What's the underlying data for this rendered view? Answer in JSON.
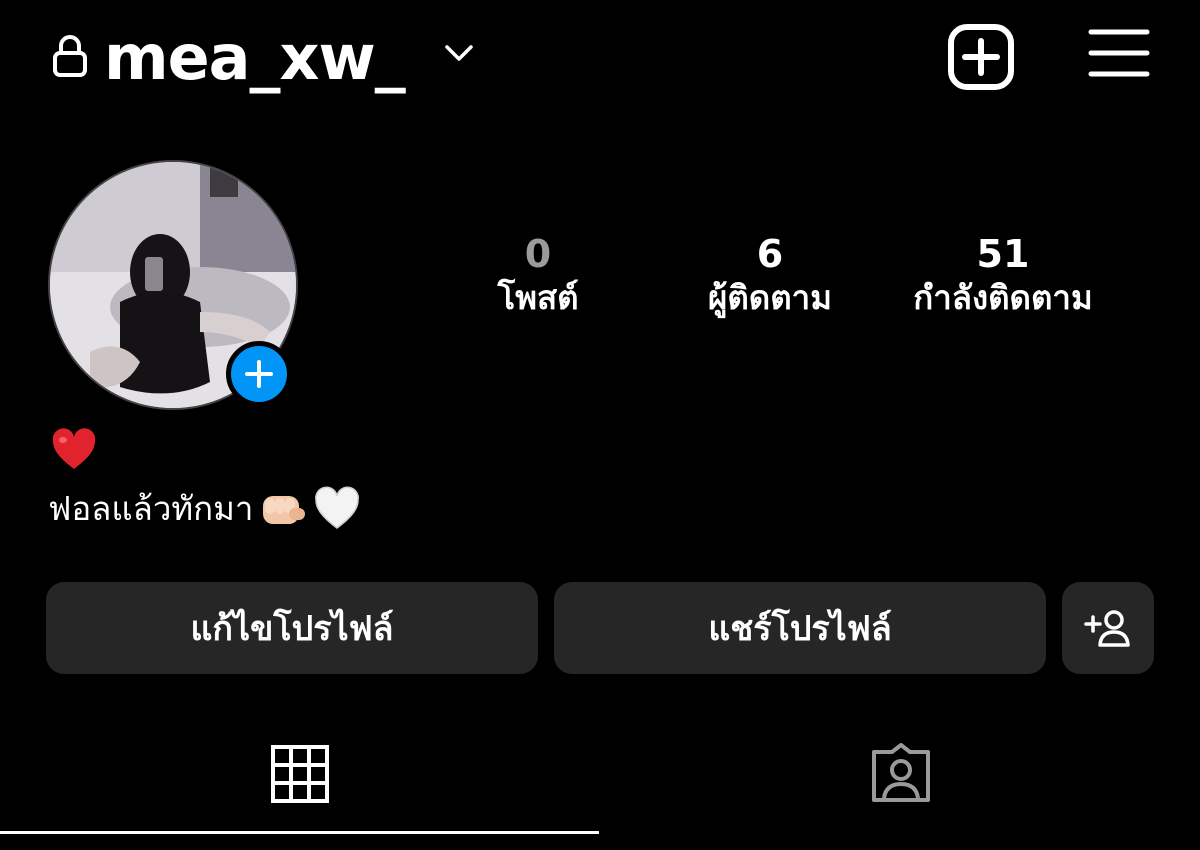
{
  "header": {
    "username": "mea_xw_",
    "icons": {
      "lock": "lock-icon",
      "chevron": "chevron-down-icon",
      "add": "add-post-icon",
      "menu": "hamburger-menu-icon"
    }
  },
  "profile": {
    "avatar_icon": "profile-photo",
    "add_story_icon": "plus-icon"
  },
  "stats": {
    "posts": {
      "value": "0",
      "label": "โพสต์"
    },
    "followers": {
      "value": "6",
      "label": "ผู้ติดตาม"
    },
    "following": {
      "value": "51",
      "label": "กำลังติดตาม"
    }
  },
  "bio": {
    "line1_emoji": "❤️",
    "line2_text": "ฟอลแล้วทักมา",
    "line2_emoji_a": "👊🏻",
    "line2_emoji_b": "🤍"
  },
  "actions": {
    "edit_profile": "แก้ไขโปรไฟล์",
    "share_profile": "แชร์โปรไฟล์",
    "add_user_icon": "add-user-icon"
  },
  "tabs": {
    "active": "grid",
    "items": [
      "grid-icon",
      "tagged-icon"
    ]
  },
  "colors": {
    "background": "#000000",
    "button_bg": "#262626",
    "accent_blue": "#0095f6",
    "muted_count": "#9b9b9b"
  }
}
